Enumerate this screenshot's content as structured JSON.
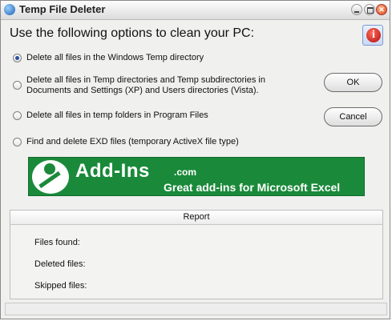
{
  "window": {
    "title": "Temp File Deleter"
  },
  "main": {
    "heading": "Use the following options to clean your PC:",
    "options": [
      {
        "label": "Delete all files in the Windows Temp directory",
        "selected": true
      },
      {
        "label": "Delete all files in Temp directories and Temp subdirectories in Documents and Settings (XP) and Users directories (Vista).",
        "selected": false
      },
      {
        "label": "Delete all files in temp folders in Program Files",
        "selected": false
      },
      {
        "label": "Find and delete EXD files (temporary ActiveX file type)",
        "selected": false
      }
    ],
    "ok_label": "OK",
    "cancel_label": "Cancel",
    "info_glyph": "i"
  },
  "banner": {
    "title": "Add-Ins",
    "domain": ".com",
    "subtitle": "Great add-ins for Microsoft Excel"
  },
  "report": {
    "header": "Report",
    "files_found_label": "Files found:",
    "deleted_files_label": "Deleted files:",
    "skipped_files_label": "Skipped files:"
  },
  "colors": {
    "banner_green": "#1a8a3a",
    "radio_dot": "#2a4fa0",
    "info_red": "#c0100f"
  },
  "icons": [
    "app-icon",
    "minimize-icon",
    "maximize-icon",
    "close-icon",
    "info-icon",
    "add-ins-logo-icon"
  ]
}
